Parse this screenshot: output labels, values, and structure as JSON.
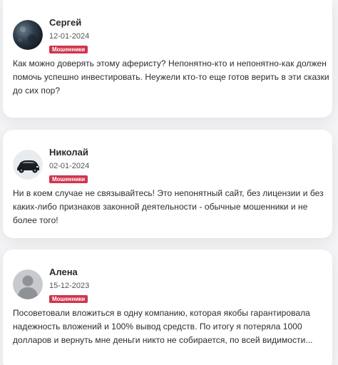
{
  "reviews": [
    {
      "author": "Сергей",
      "date": "12-01-2024",
      "badge": "Мошенники",
      "avatar_icon": "dark-planet-avatar",
      "text": "Как можно доверять этому аферисту? Непонятно-кто и непонятно-как должен помочь успешно инвестировать. Неужели кто-то еще готов верить в эти сказки до сих пор?"
    },
    {
      "author": "Николай",
      "date": "02-01-2024",
      "badge": "Мошенники",
      "avatar_icon": "car-avatar",
      "text": "Ни в коем случае не связывайтесь! Это непонятный сайт, без лицензии и без каких-либо признаков законной деятельности - обычные мошенники и не более того!"
    },
    {
      "author": "Алена",
      "date": "15-12-2023",
      "badge": "Мошенники",
      "avatar_icon": "default-user-avatar",
      "text": "Посоветовали вложиться в одну компанию, которая якобы гарантировала надежность вложений и 100% вывод средств. По итогу я потеряла 1000 долларов и вернуть мне деньги никто не собирается, по всей видимости..."
    }
  ],
  "colors": {
    "badge_background": "#d0344d",
    "card_background": "#ffffff",
    "page_background": "#f4f4f6"
  }
}
